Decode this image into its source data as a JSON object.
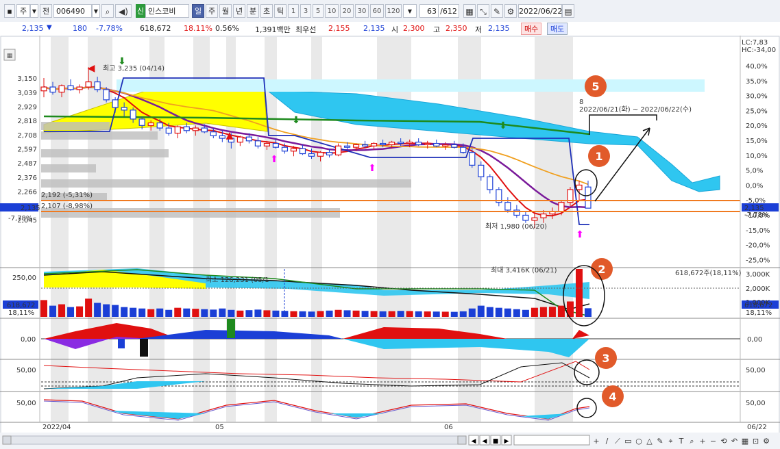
{
  "toolbar": {
    "market": "주",
    "type_label": "전",
    "code": "006490",
    "credit": "신",
    "name": "인스코비",
    "periods": [
      "일",
      "주",
      "월",
      "년",
      "분",
      "초",
      "틱"
    ],
    "numbers": [
      "1",
      "3",
      "5",
      "10",
      "20",
      "30",
      "60",
      "120"
    ],
    "count": "63",
    "count_total": "/612",
    "date": "2022/06/22"
  },
  "quote": {
    "price": "2,135",
    "arrow": "▼",
    "change": "180",
    "change_pct": "-7.78%",
    "volume": "618,672",
    "volume_pct": "18.11%",
    "turnover_pct": "0.56%",
    "amount": "1,391백만",
    "best_label": "최우선",
    "best_ask": "2,155",
    "best_bid": "2,135",
    "open_label": "시",
    "open": "2,300",
    "high_label": "고",
    "high": "2,350",
    "low_label": "저",
    "low": "2,135",
    "buy": "매수",
    "sell": "매도"
  },
  "chart_data": {
    "type": "candlestick",
    "price_axis": [
      "3,150",
      "3,039",
      "2,929",
      "2,818",
      "2,708",
      "2,597",
      "2,487",
      "2,376",
      "2,266",
      "2,045"
    ],
    "pct_axis": [
      "40,0%",
      "35,0%",
      "30,0%",
      "25,0%",
      "20,0%",
      "15,0%",
      "10,0%",
      "5,0%",
      "0,0%",
      "-5,0%",
      "-10,0%",
      "-15,0%",
      "-20,0%",
      "-25,0%"
    ],
    "lc": "LC:7,83",
    "hc": "HC:-34,00",
    "current_price": "2,135",
    "current_pct": "-7,78%",
    "line_a": "2,192 (-5,31%)",
    "line_b": "2,107 (-8,98%)",
    "high_note": "최고 3,235 (04/14)",
    "low_note": "최저 1,980 (06/20)",
    "period_top": "8",
    "period_note": "2022/06/21(화) ~ 2022/06/22(수)",
    "volume_axis": "250,00",
    "volume_left": "618,672",
    "volume_left_pct": "18,11%",
    "volume_right": "618,672",
    "volume_right_pct": "18,11%",
    "volume_right_axis": [
      "3,000K",
      "2,000K",
      "1,000K"
    ],
    "volume_min_note": "최소 126,231 (05/1",
    "volume_max_note": "최대 3,416K (06/21)",
    "volume_label": "618,672주(18,11%)",
    "macd_axis": "0,00",
    "stoch_axis": "50,00",
    "x_labels": [
      "2022/04",
      "05",
      "06",
      "06/22"
    ],
    "marks": [
      "1",
      "2",
      "3",
      "4",
      "5"
    ],
    "candles": [
      [
        3050,
        3150,
        3000,
        3080
      ],
      [
        3080,
        3120,
        3020,
        3040
      ],
      [
        3040,
        3100,
        3000,
        3090
      ],
      [
        3090,
        3140,
        3050,
        3060
      ],
      [
        3060,
        3100,
        3030,
        3080
      ],
      [
        3080,
        3235,
        3060,
        3120
      ],
      [
        3120,
        3160,
        3040,
        3060
      ],
      [
        3060,
        3080,
        2960,
        2980
      ],
      [
        2980,
        3000,
        2880,
        2920
      ],
      [
        2920,
        2960,
        2850,
        2900
      ],
      [
        2900,
        2920,
        2800,
        2830
      ],
      [
        2830,
        2850,
        2750,
        2780
      ],
      [
        2780,
        2820,
        2740,
        2800
      ],
      [
        2800,
        2830,
        2740,
        2760
      ],
      [
        2760,
        2800,
        2700,
        2720
      ],
      [
        2720,
        2780,
        2680,
        2770
      ],
      [
        2770,
        2800,
        2720,
        2740
      ],
      [
        2740,
        2780,
        2700,
        2760
      ],
      [
        2760,
        2790,
        2720,
        2730
      ],
      [
        2730,
        2760,
        2680,
        2700
      ],
      [
        2700,
        2740,
        2650,
        2680
      ],
      [
        2680,
        2720,
        2600,
        2650
      ],
      [
        2650,
        2700,
        2620,
        2690
      ],
      [
        2690,
        2720,
        2640,
        2660
      ],
      [
        2660,
        2690,
        2600,
        2620
      ],
      [
        2620,
        2660,
        2590,
        2640
      ],
      [
        2640,
        2680,
        2600,
        2610
      ],
      [
        2610,
        2640,
        2560,
        2580
      ],
      [
        2580,
        2620,
        2540,
        2600
      ],
      [
        2600,
        2630,
        2550,
        2560
      ],
      [
        2560,
        2600,
        2520,
        2540
      ],
      [
        2540,
        2580,
        2500,
        2570
      ],
      [
        2570,
        2600,
        2530,
        2550
      ],
      [
        2550,
        2640,
        2540,
        2620
      ],
      [
        2620,
        2650,
        2590,
        2610
      ],
      [
        2610,
        2640,
        2580,
        2630
      ],
      [
        2630,
        2660,
        2600,
        2620
      ],
      [
        2620,
        2650,
        2590,
        2640
      ],
      [
        2640,
        2670,
        2610,
        2630
      ],
      [
        2630,
        2660,
        2600,
        2650
      ],
      [
        2650,
        2680,
        2620,
        2640
      ],
      [
        2640,
        2670,
        2610,
        2650
      ],
      [
        2650,
        2680,
        2620,
        2630
      ],
      [
        2630,
        2660,
        2600,
        2640
      ],
      [
        2640,
        2670,
        2610,
        2620
      ],
      [
        2620,
        2650,
        2590,
        2630
      ],
      [
        2630,
        2660,
        2600,
        2610
      ],
      [
        2610,
        2640,
        2560,
        2570
      ],
      [
        2570,
        2600,
        2450,
        2470
      ],
      [
        2470,
        2500,
        2350,
        2380
      ],
      [
        2380,
        2400,
        2250,
        2280
      ],
      [
        2280,
        2300,
        2150,
        2180
      ],
      [
        2180,
        2220,
        2100,
        2120
      ],
      [
        2120,
        2160,
        2060,
        2080
      ],
      [
        2080,
        2110,
        2020,
        2040
      ],
      [
        2040,
        2100,
        1980,
        2060
      ],
      [
        2060,
        2120,
        2020,
        2090
      ],
      [
        2090,
        2140,
        2050,
        2110
      ],
      [
        2110,
        2200,
        2080,
        2180
      ],
      [
        2180,
        2300,
        2150,
        2280
      ],
      [
        2280,
        2350,
        2200,
        2315
      ],
      [
        2300,
        2350,
        2135,
        2135
      ]
    ],
    "volumes": [
      1200,
      800,
      900,
      700,
      750,
      1300,
      1000,
      900,
      850,
      700,
      650,
      600,
      550,
      600,
      500,
      650,
      600,
      580,
      550,
      520,
      600,
      500,
      450,
      480,
      520,
      470,
      450,
      430,
      410,
      400,
      380,
      420,
      450,
      500,
      470,
      450,
      430,
      420,
      400,
      410,
      430,
      420,
      400,
      390,
      380,
      370,
      360,
      400,
      600,
      800,
      700,
      650,
      600,
      550,
      500,
      650,
      700,
      720,
      800,
      1100,
      3416,
      618
    ]
  }
}
